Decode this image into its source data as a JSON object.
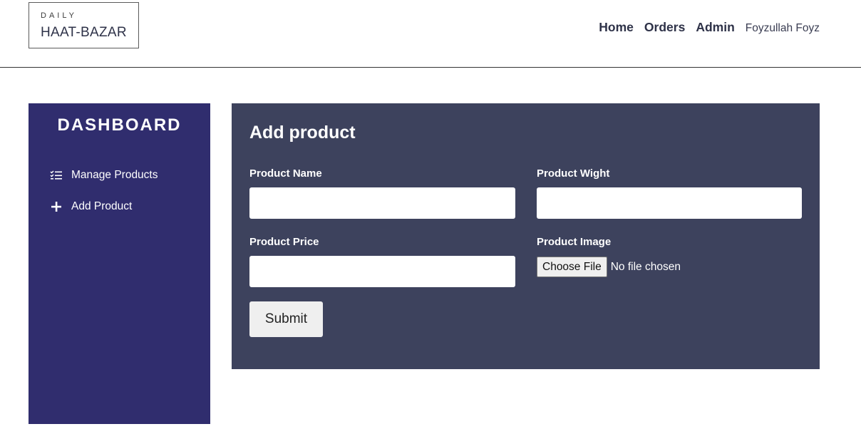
{
  "brand": {
    "top": "DAILY",
    "name": "HAAT-BAZAR"
  },
  "nav": {
    "home": "Home",
    "orders": "Orders",
    "admin": "Admin",
    "user": "Foyzullah Foyz"
  },
  "sidebar": {
    "title": "DASHBOARD",
    "items": [
      {
        "label": "Manage Products",
        "icon": "checklist-icon"
      },
      {
        "label": "Add Product",
        "icon": "plus-icon"
      }
    ]
  },
  "form": {
    "title": "Add product",
    "product_name_label": "Product Name",
    "product_name_value": "",
    "product_weight_label": "Product Wight",
    "product_weight_value": "",
    "product_price_label": "Product Price",
    "product_price_value": "",
    "product_image_label": "Product Image",
    "choose_file_label": "Choose File",
    "file_status": "No file chosen",
    "submit_label": "Submit"
  },
  "colors": {
    "sidebar_bg": "#302d6e",
    "panel_bg": "#3d425d",
    "text_dark": "#2e3248"
  }
}
